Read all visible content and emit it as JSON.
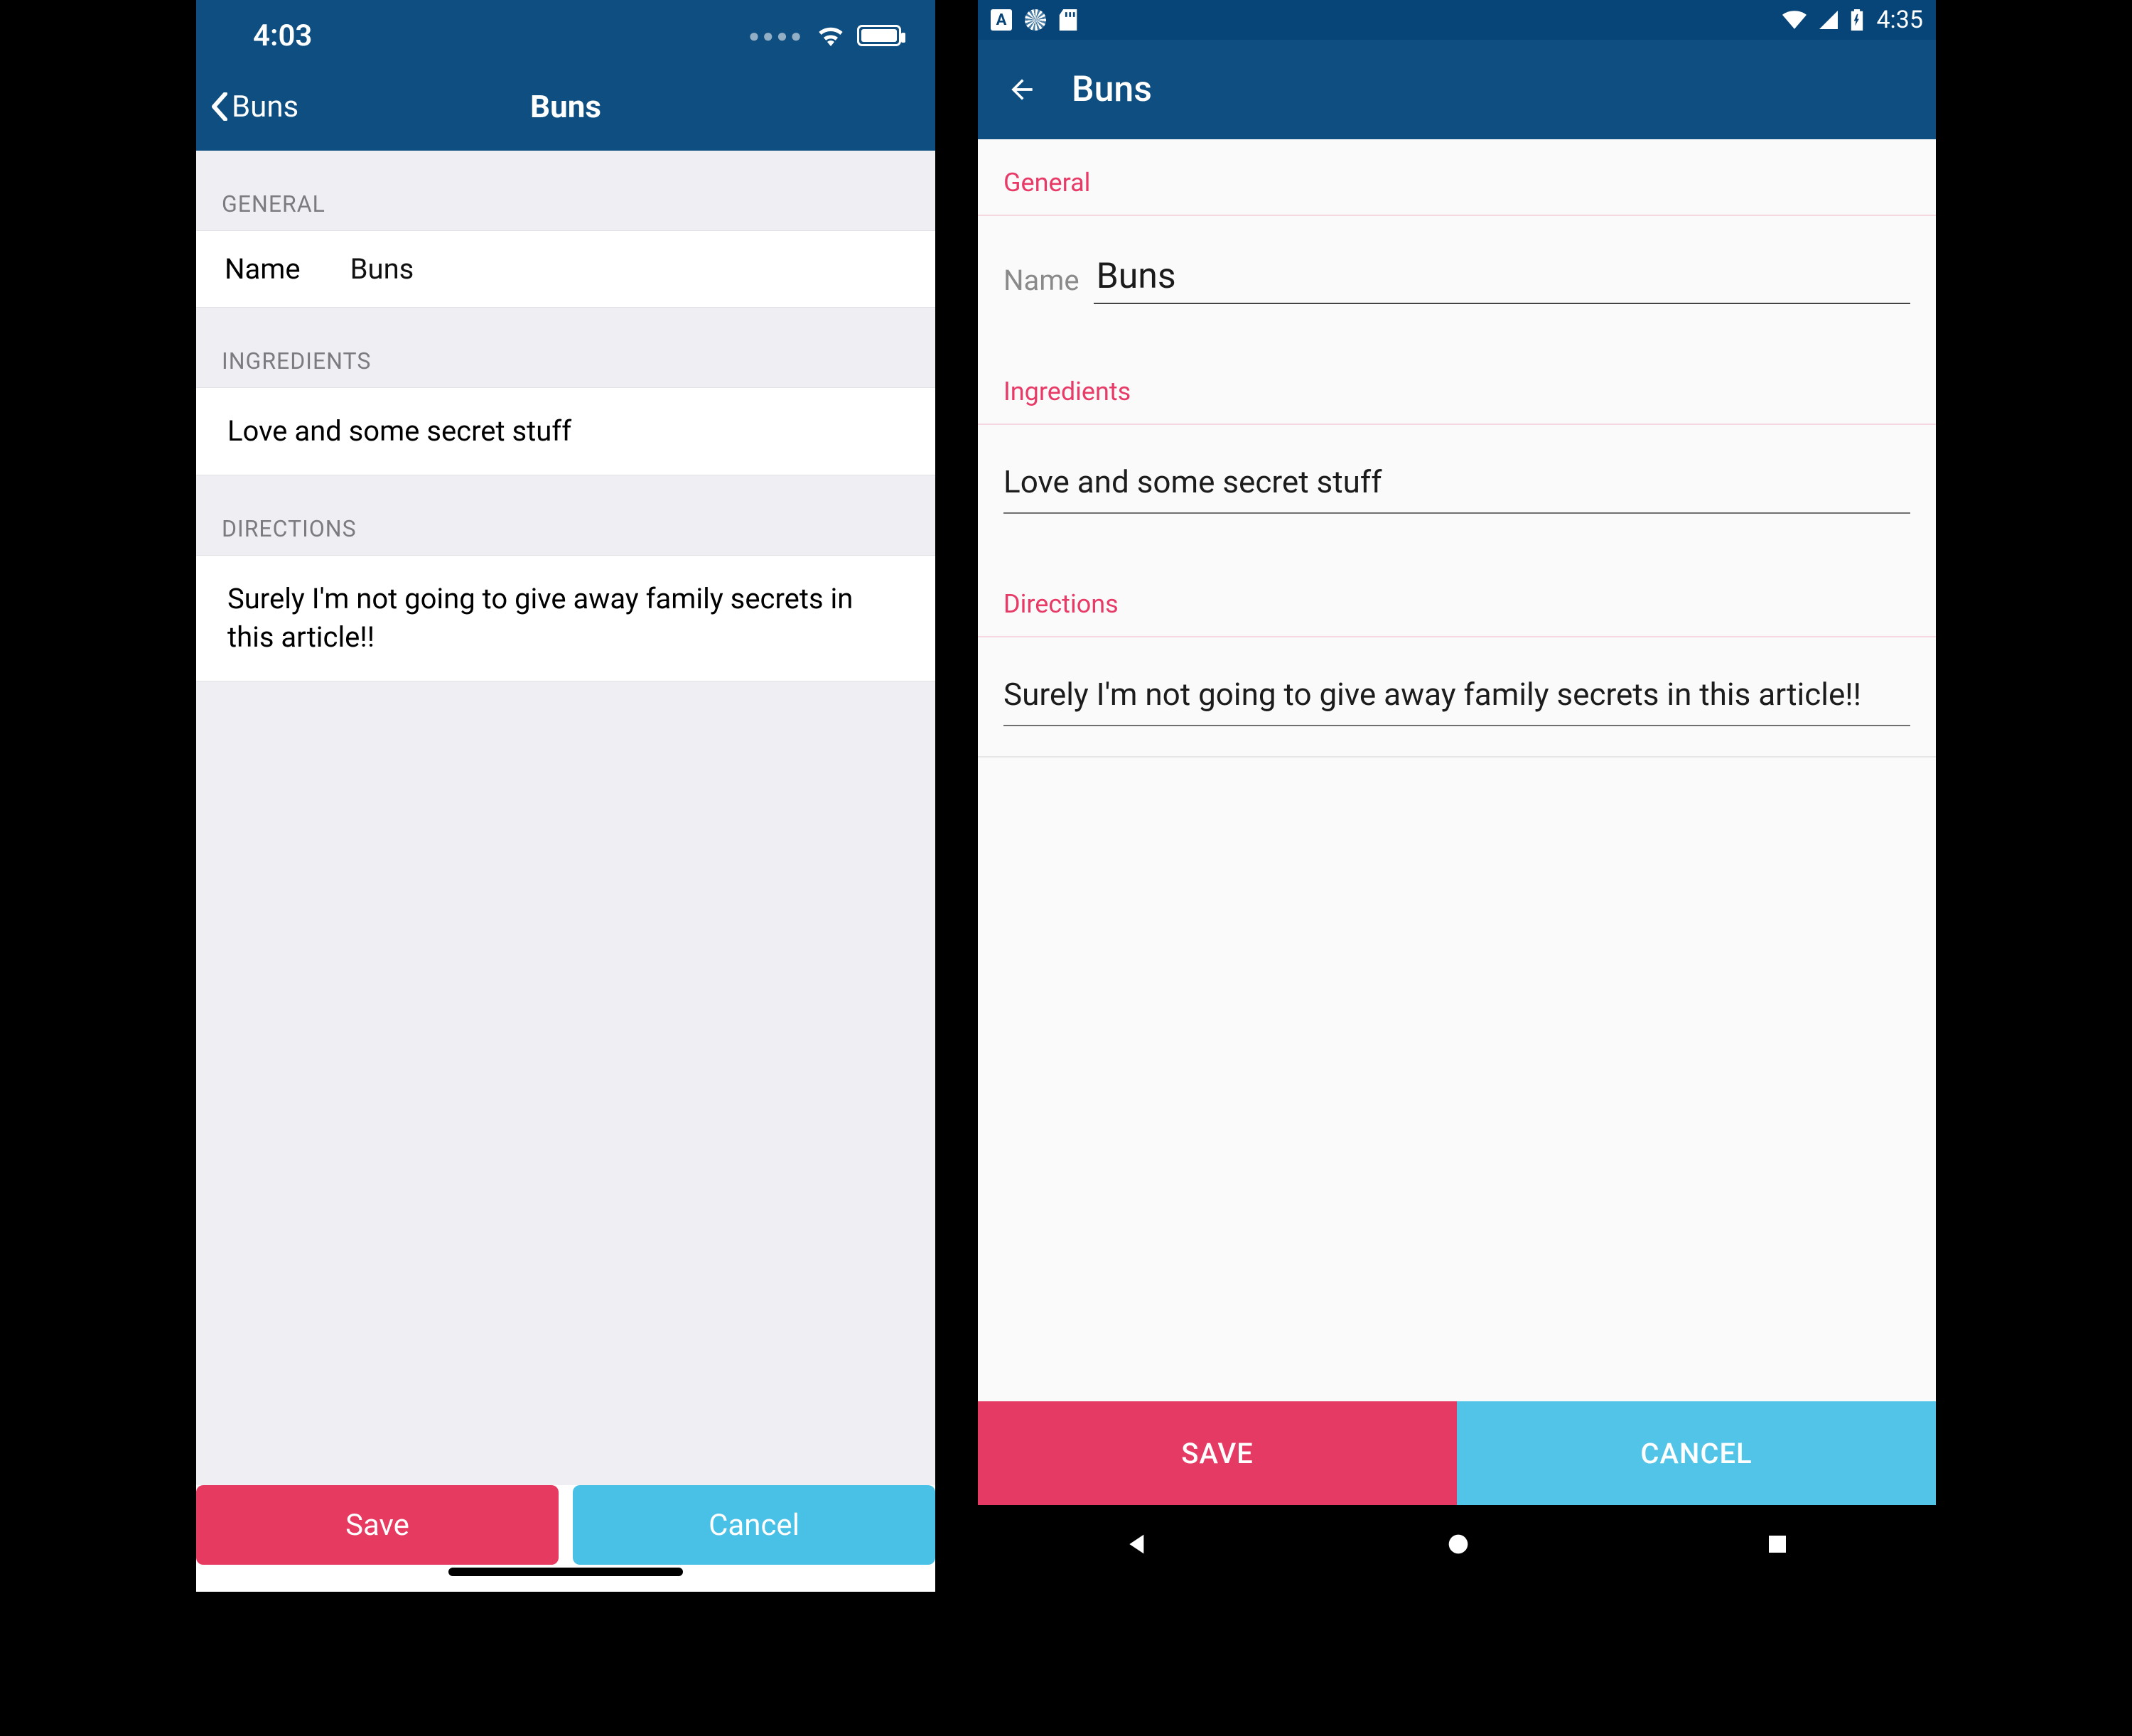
{
  "ios": {
    "status_time": "4:03",
    "back_label": "Buns",
    "title": "Buns",
    "sections": {
      "general_header": "GENERAL",
      "name_label": "Name",
      "name_value": "Buns",
      "ingredients_header": "INGREDIENTS",
      "ingredients_value": "Love and some secret stuff",
      "directions_header": "DIRECTIONS",
      "directions_value": "Surely I'm not going to give away family secrets in this article!!"
    },
    "footer": {
      "save_label": "Save",
      "cancel_label": "Cancel"
    }
  },
  "android": {
    "status_time": "4:35",
    "title": "Buns",
    "sections": {
      "general_header": "General",
      "name_label": "Name",
      "name_value": "Buns",
      "ingredients_header": "Ingredients",
      "ingredients_value": "Love and some secret stuff",
      "directions_header": "Directions",
      "directions_value": "Surely I'm not going to give away family secrets in this article!!"
    },
    "footer": {
      "save_label": "SAVE",
      "cancel_label": "CANCEL"
    }
  }
}
